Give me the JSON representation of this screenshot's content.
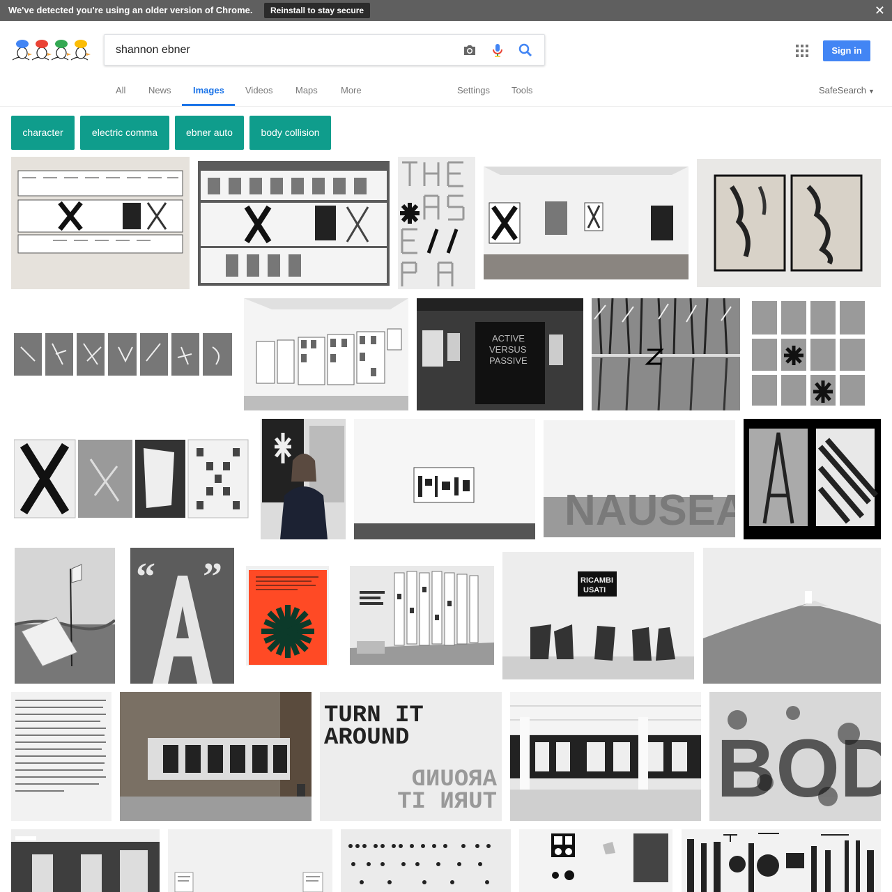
{
  "banner": {
    "message": "We've detected you're using an older version of Chrome.",
    "button": "Reinstall to stay secure",
    "close": "✕"
  },
  "search": {
    "query": "shannon ebner",
    "camera_icon": "camera-icon",
    "mic_icon": "microphone-icon",
    "search_icon": "search-icon"
  },
  "header": {
    "apps_icon": "apps-grid-icon",
    "sign_in": "Sign in"
  },
  "tabs": {
    "items": [
      "All",
      "News",
      "Images",
      "Videos",
      "Maps",
      "More"
    ],
    "active": "Images",
    "settings": "Settings",
    "tools": "Tools",
    "safesearch": "SafeSearch"
  },
  "chips": [
    "character",
    "electric comma",
    "ebner auto",
    "body collision"
  ],
  "colors": {
    "accent": "#1a73e8",
    "chip": "#0f9d8c",
    "banner": "#5f5f5f",
    "sign_in": "#4285f4"
  },
  "thumb_text": {
    "active_versus_passive": [
      "ACTIVE",
      "VERSUS",
      "PASSIVE"
    ],
    "nausea": "NAUSEA",
    "turn_it": "TURN IT",
    "around": "AROUND",
    "body": "BODY",
    "ricambi": "RICAMBI",
    "usati": "USATI"
  }
}
